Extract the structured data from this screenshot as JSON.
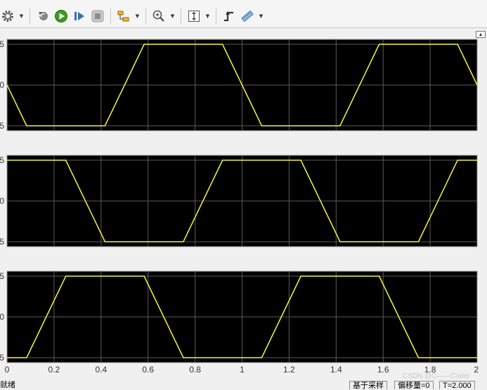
{
  "toolbar": {
    "buttons": [
      {
        "icon": "gear-icon",
        "has_dropdown": true
      },
      {
        "icon": "step-back-icon",
        "has_dropdown": false
      },
      {
        "icon": "run-icon",
        "has_dropdown": false
      },
      {
        "icon": "step-forward-icon",
        "has_dropdown": false
      },
      {
        "icon": "stop-icon",
        "has_dropdown": false
      },
      {
        "icon": "highlight-block-icon",
        "has_dropdown": true
      },
      {
        "icon": "zoom-in-icon",
        "has_dropdown": true
      },
      {
        "icon": "autoscale-icon",
        "has_dropdown": true
      },
      {
        "icon": "triggers-icon",
        "has_dropdown": false
      },
      {
        "icon": "cursor-measurements-icon",
        "has_dropdown": true
      }
    ]
  },
  "colors": {
    "plot_background": "#000000",
    "grid": "#5a5a5a",
    "trace": "#f5f536",
    "axes_frame": "#9a9a9a"
  },
  "chart_data": [
    {
      "type": "line",
      "ylim": [
        -1,
        1
      ],
      "ytick_labels": [
        "5",
        "0",
        "5"
      ],
      "x": [
        0,
        0.0833,
        0.4167,
        0.5833,
        0.9167,
        1.0833,
        1.4167,
        1.5833,
        1.9167,
        2
      ],
      "y": [
        0,
        -1,
        -1,
        1,
        1,
        -1,
        -1,
        1,
        1,
        0
      ],
      "grid": true
    },
    {
      "type": "line",
      "ylim": [
        -1,
        1
      ],
      "ytick_labels": [
        "5",
        "0",
        "5"
      ],
      "x": [
        0,
        0.25,
        0.4167,
        0.75,
        0.9167,
        1.25,
        1.4167,
        1.75,
        1.9167,
        2
      ],
      "y": [
        1,
        1,
        -1,
        -1,
        1,
        1,
        -1,
        -1,
        1,
        1
      ],
      "grid": true
    },
    {
      "type": "line",
      "ylim": [
        -1,
        1
      ],
      "ytick_labels": [
        "5",
        "0",
        "5"
      ],
      "x": [
        0,
        0.0833,
        0.25,
        0.5833,
        0.75,
        1.0833,
        1.25,
        1.5833,
        1.75,
        2
      ],
      "y": [
        -1,
        -1,
        1,
        1,
        -1,
        -1,
        1,
        1,
        -1,
        -1
      ],
      "xlim": [
        0,
        2
      ],
      "xtick_labels": [
        "0",
        "0.2",
        "0.4",
        "0.6",
        "0.8",
        "1",
        "1.2",
        "1.4",
        "1.6",
        "1.8",
        "2"
      ],
      "grid": true
    }
  ],
  "statusbar": {
    "left_text": "就绪",
    "sample_mode": "基于采样",
    "offset": "偏移量=0",
    "time": "T=2.000"
  },
  "watermark": "CSDN @C——Coder"
}
